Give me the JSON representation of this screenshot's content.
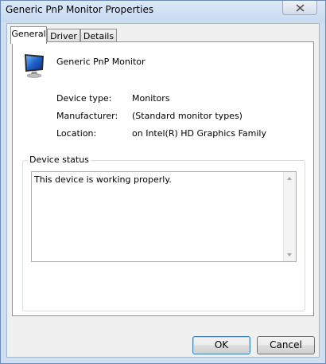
{
  "window": {
    "title": "Generic PnP Monitor Properties"
  },
  "tabs": [
    {
      "label": "General",
      "active": true
    },
    {
      "label": "Driver",
      "active": false
    },
    {
      "label": "Details",
      "active": false
    }
  ],
  "general": {
    "device_icon": "monitor-icon",
    "device_name": "Generic PnP Monitor",
    "properties": [
      {
        "label": "Device type:",
        "value": "Monitors"
      },
      {
        "label": "Manufacturer:",
        "value": "(Standard monitor types)"
      },
      {
        "label": "Location:",
        "value": "on Intel(R) HD Graphics Family"
      }
    ],
    "status_group": {
      "legend": "Device status",
      "text": "This device is working properly."
    }
  },
  "buttons": {
    "ok": "OK",
    "cancel": "Cancel"
  },
  "colors": {
    "frame": "#cfe0f3",
    "default_button_border": "#3c7fb1"
  }
}
